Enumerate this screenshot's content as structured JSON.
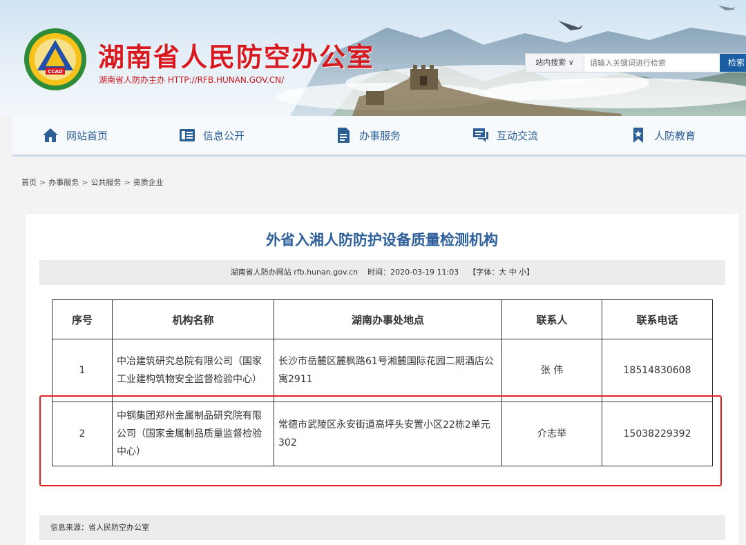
{
  "header": {
    "site_title": "湖南省人民防空办公室",
    "site_subtitle": "湖南省人防办主办 HTTP://RFB.HUNAN.GOV.CN/",
    "logo_text": "CCAD",
    "search": {
      "scope_label": "站内搜索 ∨",
      "placeholder": "请输入关键词进行检索",
      "button_label": "检索"
    }
  },
  "nav": {
    "items": [
      {
        "label": "网站首页",
        "icon": "home-icon"
      },
      {
        "label": "信息公开",
        "icon": "list-icon"
      },
      {
        "label": "办事服务",
        "icon": "document-icon"
      },
      {
        "label": "互动交流",
        "icon": "chat-icon"
      },
      {
        "label": "人防教育",
        "icon": "bookmark-star-icon"
      }
    ]
  },
  "breadcrumb": {
    "items": [
      "首页",
      "办事服务",
      "公共服务",
      "资质企业"
    ],
    "separator": ">"
  },
  "article": {
    "title": "外省入湘人防防护设备质量检测机构",
    "meta": {
      "source": "湖南省人防办网站 rfb.hunan.gov.cn",
      "time": "时间：2020-03-19 11:03",
      "font_label": "【字体：",
      "font_large": "大",
      "font_medium": "中",
      "font_small": "小",
      "font_close": "】"
    },
    "table": {
      "headers": [
        "序号",
        "机构名称",
        "湖南办事处地点",
        "联系人",
        "联系电话"
      ],
      "rows": [
        [
          "1",
          "中冶建筑研究总院有限公司（国家工业建构筑物安全监督检验中心）",
          "长沙市岳麓区麓枫路61号湘麓国际花园二期酒店公寓2911",
          "张  伟",
          "18514830608"
        ],
        [
          "2",
          "中钢集团郑州金属制品研究院有限公司（国家金属制品质量监督检验中心）",
          "常德市武陵区永安街道高坪头安置小区22栋2单元302",
          "介志举",
          "15038229392"
        ]
      ]
    },
    "info_source": "信息来源：省人民防空办公室"
  },
  "colors": {
    "title_red": "#d71920",
    "nav_blue": "#2b5f95",
    "article_title_blue": "#2d5f9a",
    "highlight_red": "#e02020",
    "search_button": "#1a5fa6"
  }
}
